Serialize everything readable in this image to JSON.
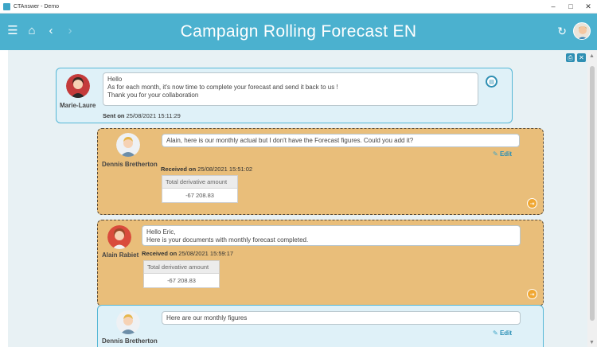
{
  "window": {
    "title": "CTAnswer - Demo",
    "minimize": "–",
    "maximize": "□",
    "close": "✕"
  },
  "header": {
    "title": "Campaign Rolling Forecast EN",
    "menu_icon": "☰",
    "home_icon": "⌂",
    "back_icon": "‹",
    "forward_icon": "›",
    "sync_icon": "↻"
  },
  "toolbar": {
    "print_icon": "⎙",
    "close_icon": "✕"
  },
  "messages": [
    {
      "author": "Marie-Laure",
      "lines": [
        "Hello",
        "As for each month, it's now time to complete your forecast and send it back to us !",
        "Thank you for your collaboration"
      ],
      "meta_label": "Sent on",
      "meta_value": "25/08/2021 15:11:29"
    },
    {
      "author": "Dennis Bretherton",
      "text": "Alain, here is our monthly actual but I don't have the Forecast figures. Could you add it?",
      "edit": "Edit",
      "meta_label": "Received on",
      "meta_value": "25/08/2021 15:51:02",
      "table_header": "Total derivative amount",
      "table_value": "-67 208.83"
    },
    {
      "author": "Alain Rabiet",
      "lines": [
        "Hello Eric,",
        "Here is your documents with monthly forecast completed."
      ],
      "meta_label": "Received on",
      "meta_value": "25/08/2021 15:59:17",
      "table_header": "Total derivative amount",
      "table_value": "-67 208.83"
    },
    {
      "author": "Dennis Bretherton",
      "text": "Here are our monthly figures",
      "edit": "Edit"
    }
  ]
}
